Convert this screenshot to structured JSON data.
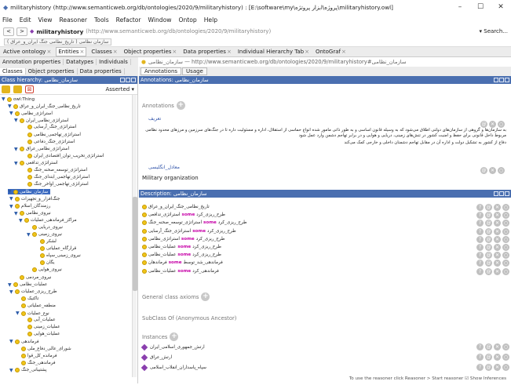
{
  "window": {
    "title": "militaryhistory (http://www.semanticweb.org/db/ontologies/2020/9/militaryhistory) : [E:\\software\\my\\پروژه\\ابزار پروتژه\\militaryhistory.owl]",
    "min": "–",
    "max": "☐",
    "close": "✕"
  },
  "menu": [
    "File",
    "Edit",
    "View",
    "Reasoner",
    "Tools",
    "Refactor",
    "Window",
    "Ontop",
    "Help"
  ],
  "address": {
    "back": "<",
    "fwd": ">",
    "ontology": "militaryhistory",
    "iri": "(http://www.semanticweb.org/db/ontologies/2020/9/militaryhistory)",
    "search": "▾ Search..."
  },
  "breadcrumb": "سازمان نظامی ( تاریخ_نظامی جنگ ایران_و_عراق )",
  "tabs": [
    "Active ontology",
    "Entities",
    "Classes",
    "Object properties",
    "Data properties",
    "Individual Hierarchy Tab",
    "OntoGraf"
  ],
  "left": {
    "row1": [
      "Annotation properties",
      "Datatypes",
      "Individuals"
    ],
    "row2": [
      "Classes",
      "Object properties",
      "Data properties"
    ],
    "header": "Class hierarchy: سازمان_نظامی",
    "asserted": "Asserted ▾",
    "tree": [
      {
        "label": "owl:Thing",
        "t": "▼"
      },
      {
        "label": "تاریخ_نظامی_جنگ_ایران_و_عراق",
        "t": "▼"
      },
      {
        "label": "استراتژی_نظامی",
        "t": "▼"
      },
      {
        "label": "استراتژی_نظامی_ایران",
        "t": "▼"
      },
      {
        "label": "استراتژی_جنگ_آرسایی",
        "t": ""
      },
      {
        "label": "استراتژی_تهاجمی_نظامی",
        "t": ""
      },
      {
        "label": "استراتژی_جنگ_دفاعی",
        "t": ""
      },
      {
        "label": "استراتژی_نظامی_عراق",
        "t": "▼"
      },
      {
        "label": "استراتژی_تخریب_توان_اقتصادی_ایران",
        "t": ""
      },
      {
        "label": "استراتژی_تدافعی",
        "t": "▼"
      },
      {
        "label": "استراتژی_توسعه_صحنه_جنگ",
        "t": ""
      },
      {
        "label": "استراتژی_تهاجمی_ابتدای_جنگ",
        "t": ""
      },
      {
        "label": "استراتژی_تهاجمی_اواخر_جنگ",
        "t": ""
      },
      {
        "label": "سازمان_نظامی",
        "t": "▼",
        "sel": true
      },
      {
        "label": "جنگ‌افزار_و_تجهیزات",
        "t": "▼"
      },
      {
        "label": "رزمندگان_اسلام",
        "t": "▼"
      },
      {
        "label": "نیروی_نظامی",
        "t": "▼"
      },
      {
        "label": "مراکز_فرماندهی_عملیات",
        "t": "▼"
      },
      {
        "label": "نیروی_دریایی",
        "t": ""
      },
      {
        "label": "نیروی_زمینی",
        "t": "▼"
      },
      {
        "label": "لشکر",
        "t": ""
      },
      {
        "label": "قرارگاه_عملیاتی",
        "t": ""
      },
      {
        "label": "نیروی_زمینی_سپاه",
        "t": ""
      },
      {
        "label": "یگان",
        "t": ""
      },
      {
        "label": "نیروی_هوایی",
        "t": ""
      },
      {
        "label": "نیروی_مردمی",
        "t": ""
      },
      {
        "label": "عملیات_نظامی",
        "t": "▼"
      },
      {
        "label": "طرح_ریزی_عملیات",
        "t": "▼"
      },
      {
        "label": "تاکتیک",
        "t": ""
      },
      {
        "label": "منطقه_عملیاتی",
        "t": ""
      },
      {
        "label": "نوع_عملیات",
        "t": "▼"
      },
      {
        "label": "عملیات_آبی",
        "t": ""
      },
      {
        "label": "عملیات_زمینی",
        "t": ""
      },
      {
        "label": "عملیات_هوایی",
        "t": ""
      },
      {
        "label": "فرماندهی",
        "t": "▼"
      },
      {
        "label": "شورای_عالی_دفاع_ملی",
        "t": ""
      },
      {
        "label": "فرمانده_کل_قوا",
        "t": ""
      },
      {
        "label": "فرماندهی_جنگ",
        "t": ""
      },
      {
        "label": "پشتیبانی_جنگ",
        "t": "▼"
      }
    ]
  },
  "right": {
    "iri": "سازمان_نظامی — http://www.semanticweb.org/db/ontologies/2020/9/militaryhistory#سازمان_نظامی",
    "subtabs": [
      "Annotations",
      "Usage"
    ],
    "annHeader": "Annotations: سازمان_نظامی",
    "annLabel": "Annotations",
    "ann1prop": "تعریف",
    "ann1text": "به سازمان‌ها و گروهی از سازمان‌های دولتی اطلاق می‌شود که به وسیله قانون اساسی و به طور ذاتی مامور شده انواع حماسی از استقلال، اداره و مسئولیت داره تا در جنگ‌های سرزمین و مرزهای محدود نظامی مربوط داخل قانونی برای حفظ و امنیت کشور در تنش‌های زمینی، دریایی و هوایی و در برابر تهاجم دشمن وارد عمل شود",
    "ann1more": "دفاع از کشور به تشکیل دولت و اداره آن در مقابل تهاجم دشمنان داخلی و خارجی کمک می‌کند",
    "ann2prop": "معادل_انگلیسی",
    "ann2text": "Military organization",
    "descHeader": "Description: سازمان_نظامی",
    "equivalents": [
      {
        "pre": "",
        "kw": "",
        "post": "تاریخ_نظامی_جنگ_ایران_و_عراق"
      },
      {
        "pre": "طرح_ریزی_کرد",
        "kw": "some",
        "post": "استراتژی_تدافعی"
      },
      {
        "pre": "طرح_ریزی_کرد",
        "kw": "some",
        "post": "استراتژی_توسعه_صحنه_جنگ"
      },
      {
        "pre": "طرح_ریزی_کرد",
        "kw": "some",
        "post": "استراتژی_جنگ_آرسایی"
      },
      {
        "pre": "طرح_ریزی_کرد",
        "kw": "some",
        "post": "استراتژی_نظامی"
      },
      {
        "pre": "طرح_ریزی_کرد",
        "kw": "some",
        "post": "عملیات_نظامی"
      },
      {
        "pre": "طرح_ریزی_کرد",
        "kw": "some",
        "post": "عملیات_نظامی"
      },
      {
        "pre": "فرماندهی_شد_توسط",
        "kw": "some",
        "post": "فرماندهان"
      },
      {
        "pre": "فرماندهی_کرد",
        "kw": "some",
        "post": "عملیات_نظامی"
      }
    ],
    "gca": "General class axioms",
    "subclassOf": "SubClass Of (Anonymous Ancestor)",
    "instancesLbl": "Instances",
    "instances": [
      "ارتش_جمهوری_اسلامی_ایران",
      "ارتش_عراق",
      "سپاه_پاسداران_انقلاب_اسلامی"
    ],
    "status": "To use the reasoner click Reasoner > Start reasoner   ☑ Show Inferences"
  }
}
